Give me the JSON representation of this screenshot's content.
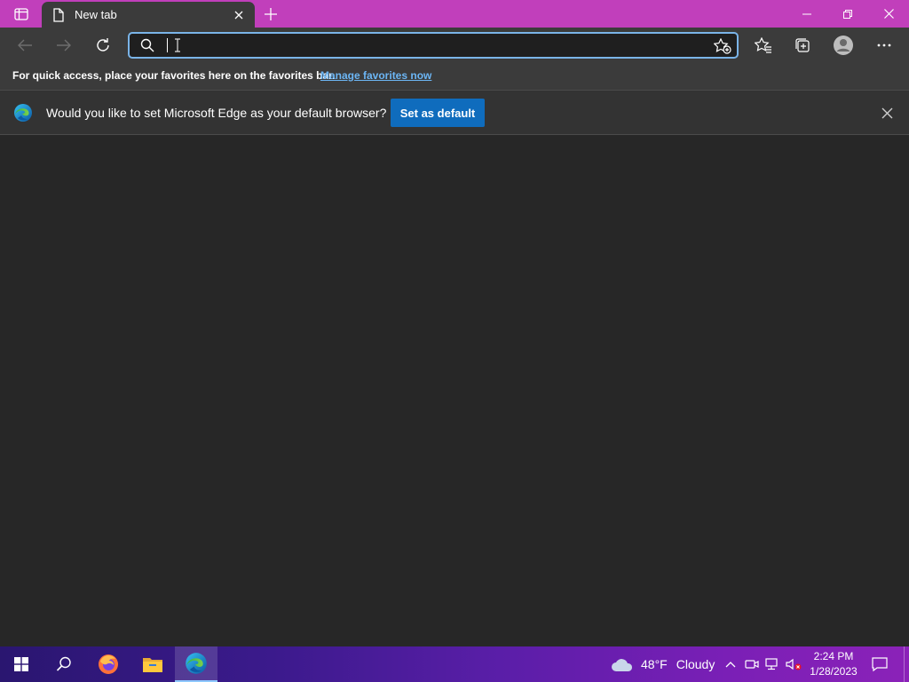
{
  "tab": {
    "title": "New tab"
  },
  "addressbar": {
    "value": "",
    "placeholder": ""
  },
  "favbar": {
    "text": "For quick access, place your favorites here on the favorites bar.",
    "link": "Manage favorites now"
  },
  "infobar": {
    "text": "Would you like to set Microsoft Edge as your default browser?",
    "button": "Set as default"
  },
  "taskbar": {
    "weather_temp": "48°F",
    "weather_condition": "Cloudy",
    "time": "2:24 PM",
    "date": "1/28/2023"
  },
  "colors": {
    "titlebar": "#c13fbb",
    "toolbar": "#3b3b3b",
    "content": "#272727",
    "accent_button": "#0f6cbd",
    "link": "#6cb6f5"
  }
}
